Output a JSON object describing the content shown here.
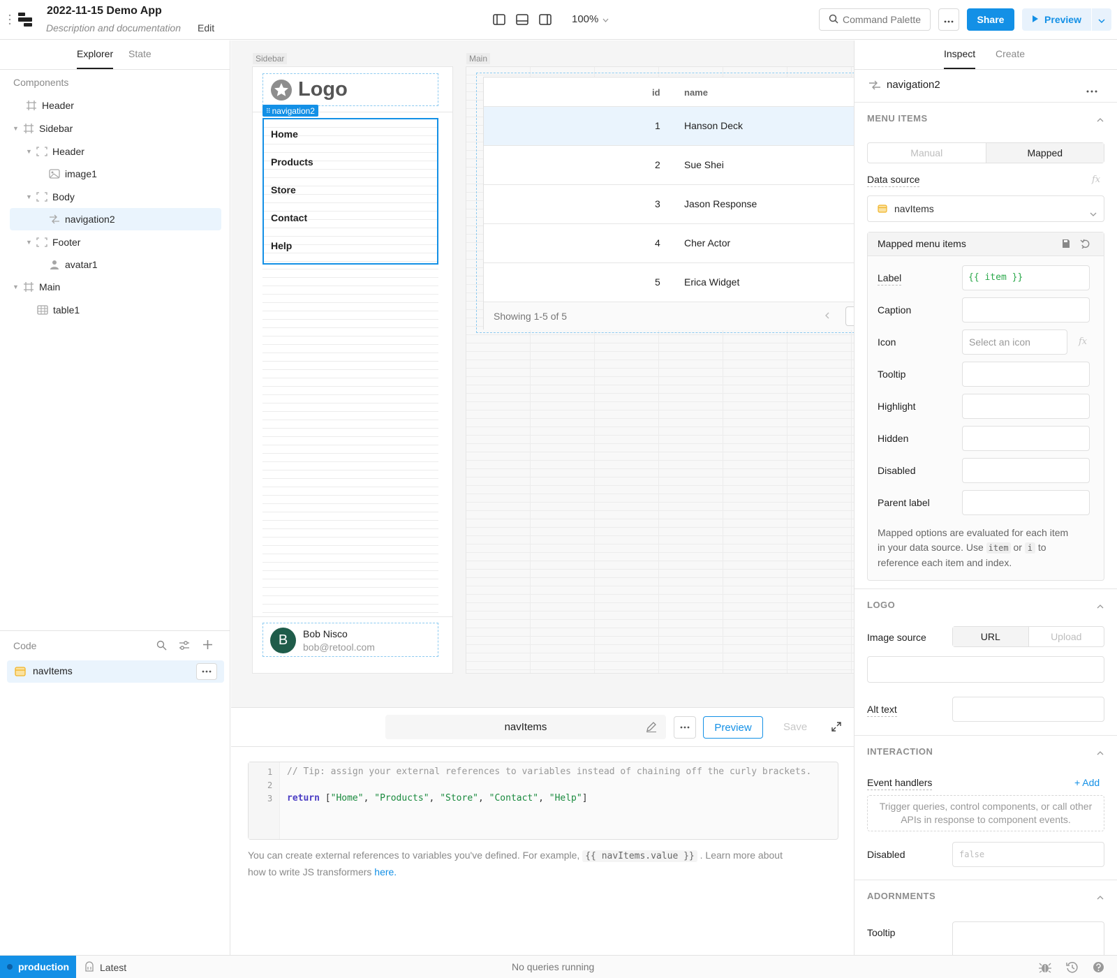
{
  "app": {
    "title": "2022-11-15 Demo App",
    "description": "Description and documentation",
    "edit_label": "Edit",
    "zoom": "100%",
    "command_palette": "Command Palette",
    "share": "Share",
    "preview": "Preview"
  },
  "left": {
    "tabs": [
      "Explorer",
      "State"
    ],
    "components_heading": "Components",
    "tree": [
      {
        "label": "Header"
      },
      {
        "label": "Sidebar"
      },
      {
        "label": "Header"
      },
      {
        "label": "image1"
      },
      {
        "label": "Body"
      },
      {
        "label": "navigation2"
      },
      {
        "label": "Footer"
      },
      {
        "label": "avatar1"
      },
      {
        "label": "Main"
      },
      {
        "label": "table1"
      }
    ],
    "code_heading": "Code",
    "code_item": "navItems"
  },
  "canvas": {
    "sidebar_tag": "Sidebar",
    "main_tag": "Main",
    "logo_text": "Logo",
    "nav_badge": "navigation2",
    "nav_items": [
      "Home",
      "Products",
      "Store",
      "Contact",
      "Help"
    ],
    "avatar_initial": "B",
    "avatar_name": "Bob Nisco",
    "avatar_email": "bob@retool.com",
    "table": {
      "headers": [
        "id",
        "name"
      ],
      "rows": [
        {
          "id": "1",
          "name": "Hanson Deck"
        },
        {
          "id": "2",
          "name": "Sue Shei"
        },
        {
          "id": "3",
          "name": "Jason Response"
        },
        {
          "id": "4",
          "name": "Cher Actor"
        },
        {
          "id": "5",
          "name": "Erica Widget"
        }
      ],
      "footer": "Showing 1-5 of 5"
    }
  },
  "editor": {
    "name": "navItems",
    "preview": "Preview",
    "save": "Save",
    "line_numbers": [
      "1",
      "2",
      "3"
    ],
    "line1": "// Tip: assign your external references to variables instead of chaining off the curly brackets.",
    "line3_keyword": "return",
    "line3_open": " [",
    "line3_strings": [
      "\"Home\"",
      "\"Products\"",
      "\"Store\"",
      "\"Contact\"",
      "\"Help\""
    ],
    "line3_sep": ", ",
    "line3_close": "]",
    "help_before": "You can create external references to variables you've defined. For example,",
    "help_code": "{{ navItems.value }}",
    "help_after": ". Learn more about",
    "help_line2": "how to write JS transformers",
    "help_link": "here."
  },
  "right": {
    "tabs": [
      "Inspect",
      "Create"
    ],
    "component_name": "navigation2",
    "menu_items_title": "MENU ITEMS",
    "mode_manual": "Manual",
    "mode_mapped": "Mapped",
    "data_source_label": "Data source",
    "data_source_value": "navItems",
    "mapped_header": "Mapped menu items",
    "fields": [
      {
        "label": "Label",
        "value": "{{ item }}"
      },
      {
        "label": "Caption",
        "value": ""
      },
      {
        "label": "Icon",
        "placeholder": "Select an icon"
      },
      {
        "label": "Tooltip",
        "value": ""
      },
      {
        "label": "Highlight",
        "value": ""
      },
      {
        "label": "Hidden",
        "value": ""
      },
      {
        "label": "Disabled",
        "value": ""
      },
      {
        "label": "Parent label",
        "value": ""
      }
    ],
    "mapped_help_1": "Mapped options are evaluated for each item",
    "mapped_help_2a": "in your data source. Use",
    "mapped_help_code1": "item",
    "mapped_help_or": "or",
    "mapped_help_code2": "i",
    "mapped_help_to": "to",
    "mapped_help_3": "reference each item and index.",
    "logo_title": "LOGO",
    "image_source_label": "Image source",
    "image_source_url": "URL",
    "image_source_upload": "Upload",
    "alt_text_label": "Alt text",
    "interaction_title": "INTERACTION",
    "event_handlers_label": "Event handlers",
    "add_label": "+ Add",
    "event_help": "Trigger queries, control components, or call other APIs in response to component events.",
    "disabled_label": "Disabled",
    "disabled_placeholder": "false",
    "adornments_title": "ADORNMENTS",
    "tooltip_label": "Tooltip",
    "fx": "fx"
  },
  "status": {
    "env": "production",
    "version": "Latest",
    "queries": "No queries running"
  },
  "colors": {
    "accent": "#1390e6",
    "selected_bg": "#eaf4fd",
    "avatar_bg": "#1f5c4a"
  }
}
